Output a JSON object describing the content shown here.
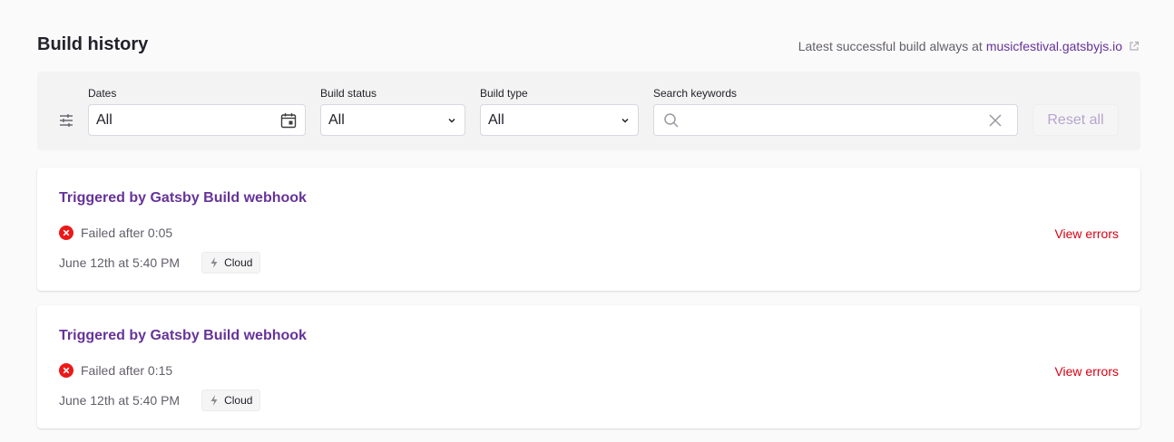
{
  "header": {
    "title": "Build history",
    "latest_prefix": "Latest successful build always at",
    "latest_link": "musicfestival.gatsbyjs.io"
  },
  "filters": {
    "dates": {
      "label": "Dates",
      "value": "All"
    },
    "build_status": {
      "label": "Build status",
      "value": "All"
    },
    "build_type": {
      "label": "Build type",
      "value": "All"
    },
    "search": {
      "label": "Search keywords",
      "value": ""
    },
    "reset_label": "Reset all"
  },
  "builds": [
    {
      "title": "Triggered by Gatsby Build webhook",
      "status": "Failed after 0:05",
      "date": "June 12th at 5:40 PM",
      "badge": "Cloud",
      "action": "View errors"
    },
    {
      "title": "Triggered by Gatsby Build webhook",
      "status": "Failed after 0:15",
      "date": "June 12th at 5:40 PM",
      "badge": "Cloud",
      "action": "View errors"
    }
  ],
  "colors": {
    "brand_purple": "#663399",
    "error_red": "#da0013",
    "fail_icon_red": "#ec1818"
  },
  "icons": [
    "sliders-icon",
    "calendar-icon",
    "chevron-down-icon",
    "search-icon",
    "clear-icon",
    "external-link-icon",
    "failed-icon",
    "bolt-icon"
  ]
}
